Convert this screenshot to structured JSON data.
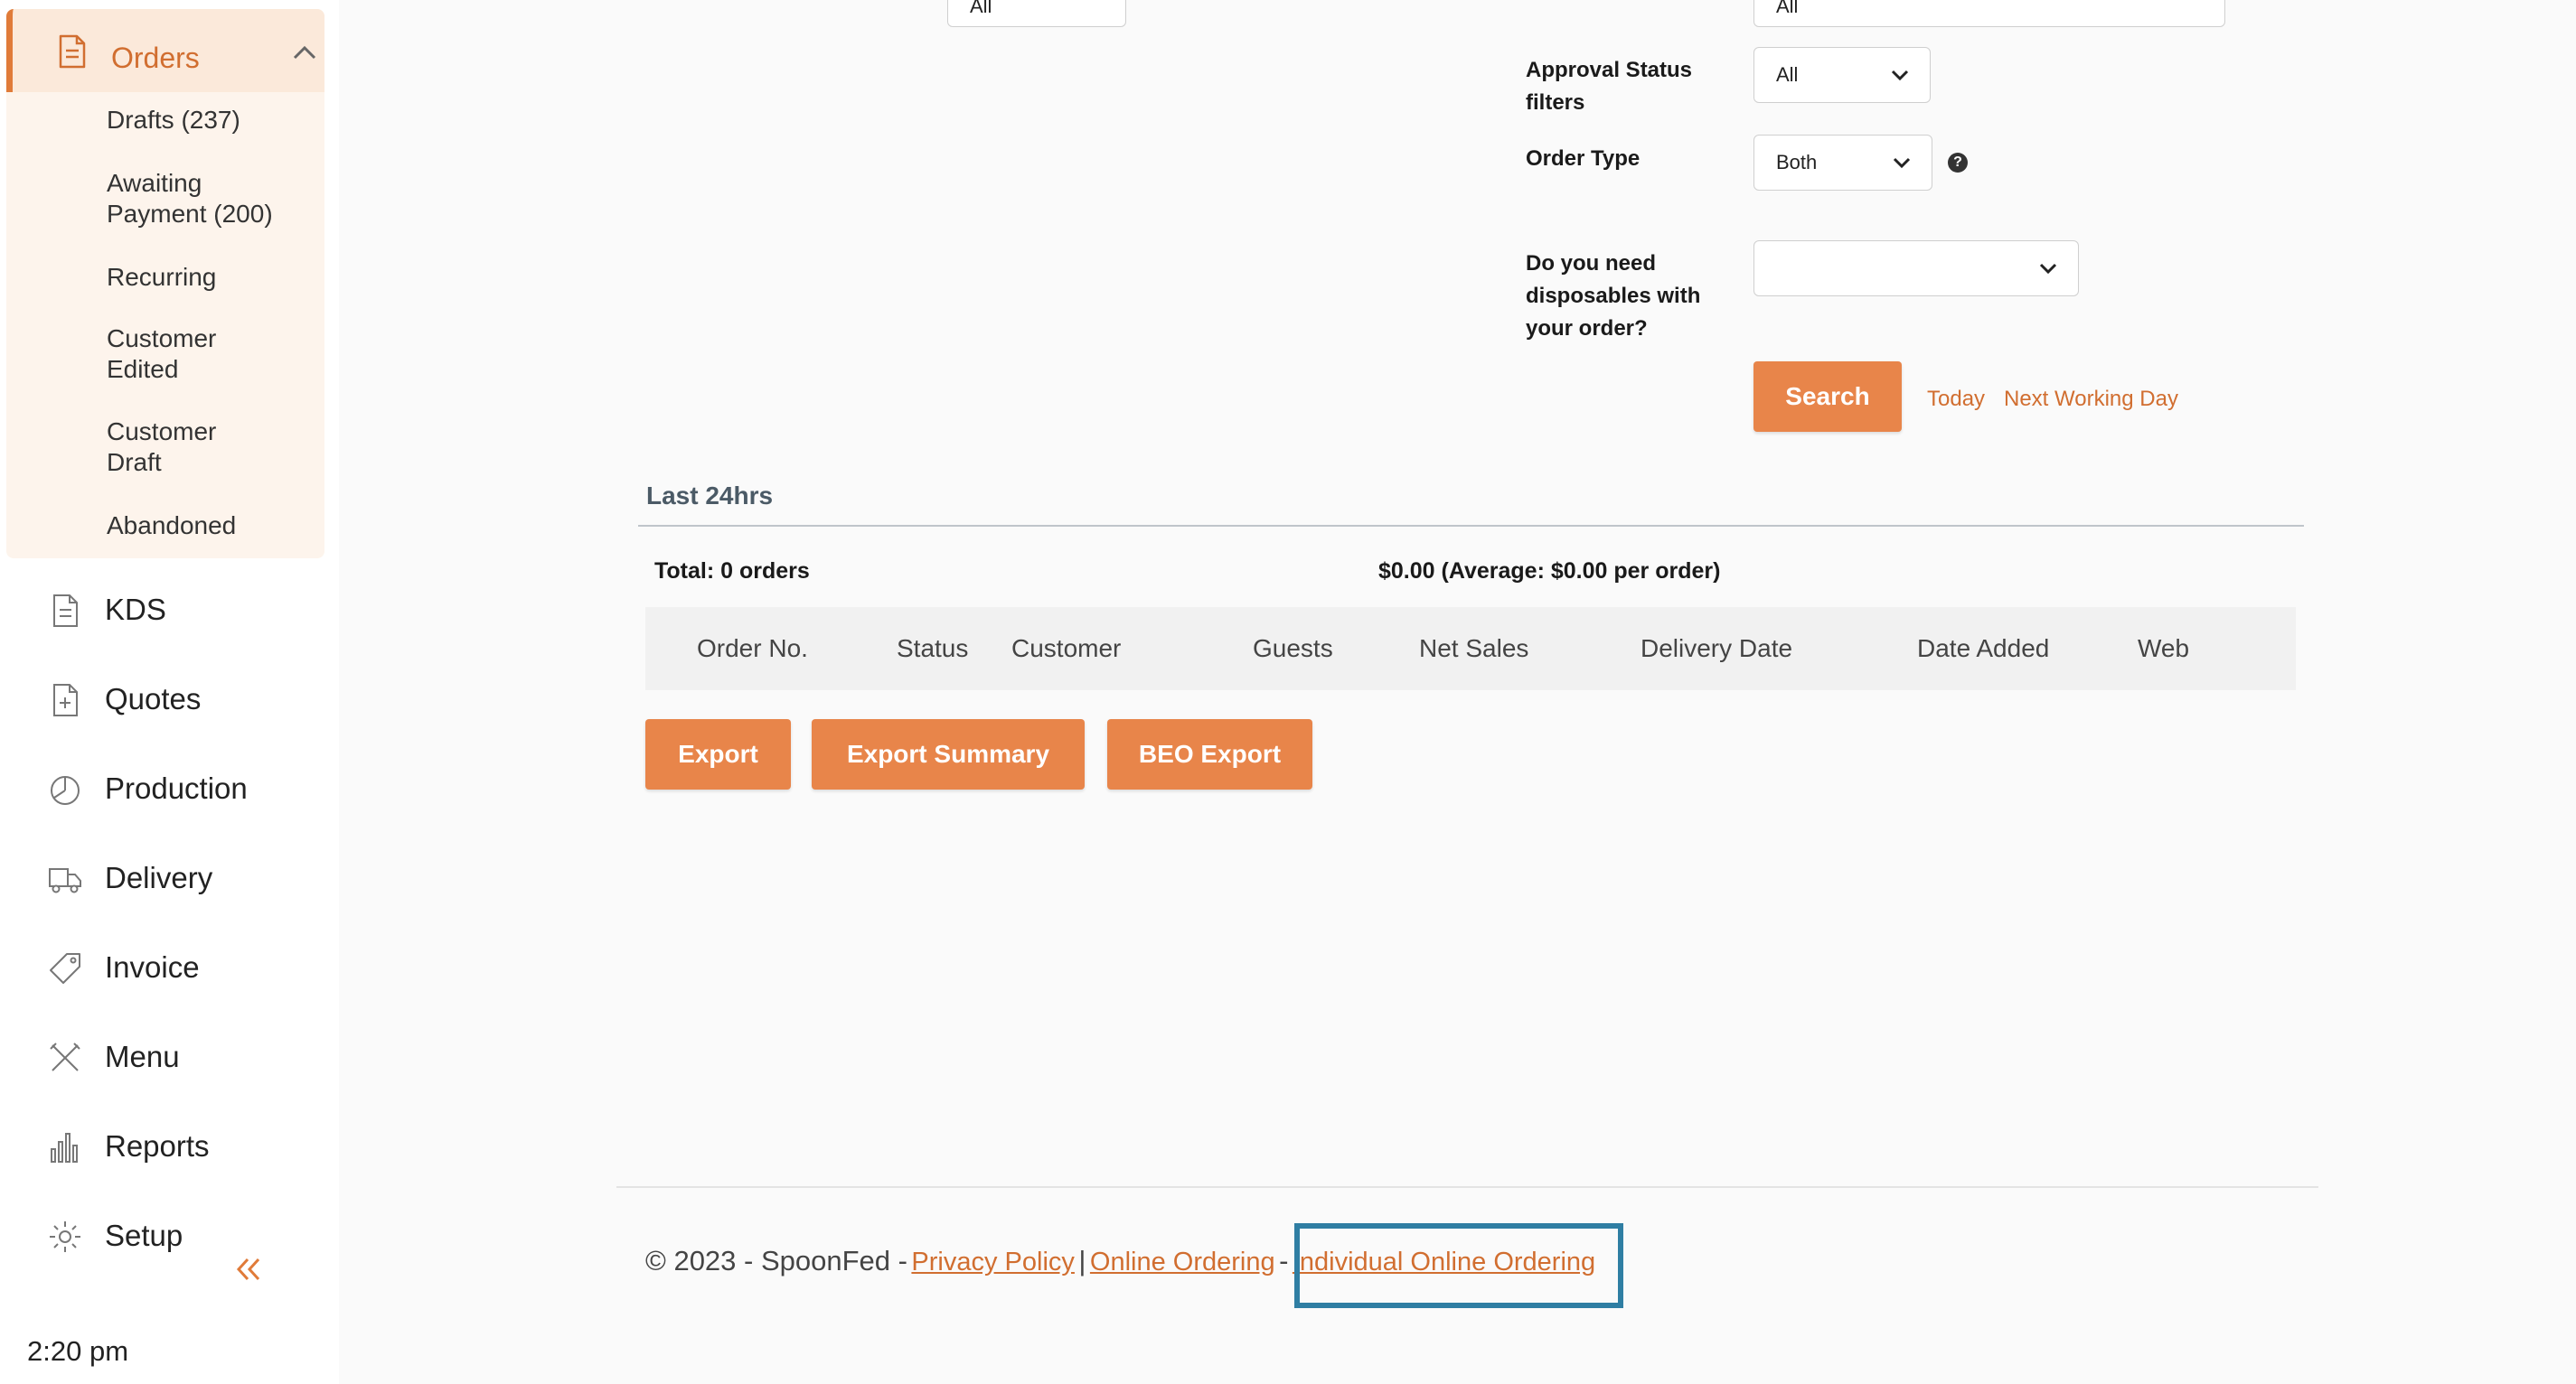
{
  "sidebar": {
    "orders": {
      "label": "Orders",
      "items": [
        "Drafts (237)",
        "Awaiting",
        "Payment (200)",
        "Recurring",
        "Customer",
        "Edited",
        "Customer",
        "Draft",
        "Abandoned"
      ]
    },
    "nav": [
      {
        "label": "KDS",
        "icon": "document-icon"
      },
      {
        "label": "Quotes",
        "icon": "quote-document-icon"
      },
      {
        "label": "Production",
        "icon": "pie-chart-icon"
      },
      {
        "label": "Delivery",
        "icon": "truck-icon"
      },
      {
        "label": "Invoice",
        "icon": "tag-icon"
      },
      {
        "label": "Menu",
        "icon": "utensils-icon"
      },
      {
        "label": "Reports",
        "icon": "bar-chart-icon"
      },
      {
        "label": "Setup",
        "icon": "gear-icon"
      }
    ],
    "collapse_icon": "double-chevron-left-icon",
    "time": "2:20 pm"
  },
  "filters": {
    "top_select_left_value": "All",
    "top_select_right_value": "All",
    "approval_status": {
      "label_line1": "Approval Status",
      "label_line2": "filters",
      "value": "All"
    },
    "order_type": {
      "label": "Order Type",
      "value": "Both"
    },
    "disposables": {
      "label_line1": "Do you need",
      "label_line2": "disposables with",
      "label_line3": "your order?",
      "value": ""
    },
    "help_symbol": "?",
    "search_button": "Search",
    "today_link": "Today",
    "next_working_day_link": "Next Working Day"
  },
  "results": {
    "section_title": "Last 24hrs",
    "total": "Total: 0 orders",
    "summary": "$0.00 (Average: $0.00 per order)",
    "columns": [
      "Order No.",
      "Status",
      "Customer",
      "Guests",
      "Net Sales",
      "Delivery Date",
      "Date Added",
      "Web"
    ],
    "rows": []
  },
  "actions": {
    "export": "Export",
    "export_summary": "Export Summary",
    "beo_export": "BEO Export"
  },
  "footer": {
    "copyright": "© 2023 - SpoonFed -",
    "privacy_policy": "Privacy Policy",
    "separator": "|",
    "online_ordering": "Online Ordering",
    "dash": "-",
    "individual_online_ordering": "Individual Online Ordering"
  },
  "colors": {
    "accent": "#e8854a",
    "link": "#d16e30",
    "highlight": "#2f7ea3"
  }
}
